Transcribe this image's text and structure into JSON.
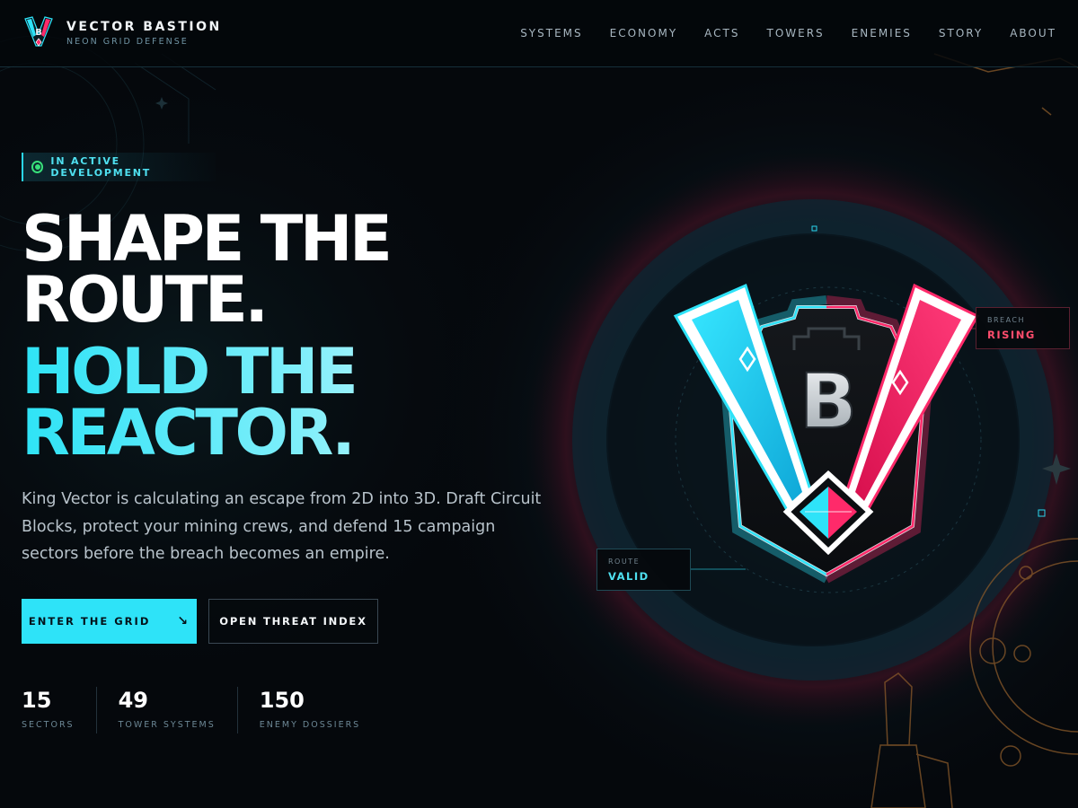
{
  "brand": {
    "name": "VECTOR BASTION",
    "tagline": "NEON GRID DEFENSE",
    "logo_letter": "B"
  },
  "nav": {
    "items": [
      {
        "label": "SYSTEMS"
      },
      {
        "label": "ECONOMY"
      },
      {
        "label": "ACTS"
      },
      {
        "label": "TOWERS"
      },
      {
        "label": "ENEMIES"
      },
      {
        "label": "STORY"
      },
      {
        "label": "ABOUT"
      }
    ]
  },
  "hero": {
    "badge": "IN ACTIVE DEVELOPMENT",
    "headline_white": [
      "SHAPE THE",
      "ROUTE."
    ],
    "headline_cyan": [
      "HOLD THE",
      "REACTOR."
    ],
    "intro": "King Vector is calculating an escape from 2D into 3D. Draft Circuit Blocks, protect your mining crews, and defend 15 campaign sectors before the breach becomes an empire.",
    "primary_cta": "ENTER THE GRID",
    "primary_cta_icon": "arrow-down-right-icon",
    "secondary_cta": "OPEN THREAT INDEX"
  },
  "stats": [
    {
      "value": "15",
      "label": "SECTORS"
    },
    {
      "value": "49",
      "label": "TOWER SYSTEMS"
    },
    {
      "value": "150",
      "label": "ENEMY DOSSIERS"
    }
  ],
  "emblem": {
    "letter": "B",
    "breach": {
      "label": "BREACH",
      "value": "RISING"
    },
    "route": {
      "label": "ROUTE",
      "value": "VALID"
    }
  },
  "colors": {
    "background": "#05080c",
    "accent_cyan": "#2ee3f8",
    "accent_pink": "#ff2a6a",
    "status_green": "#38e07a",
    "gold_lineart": "#a0672c"
  }
}
